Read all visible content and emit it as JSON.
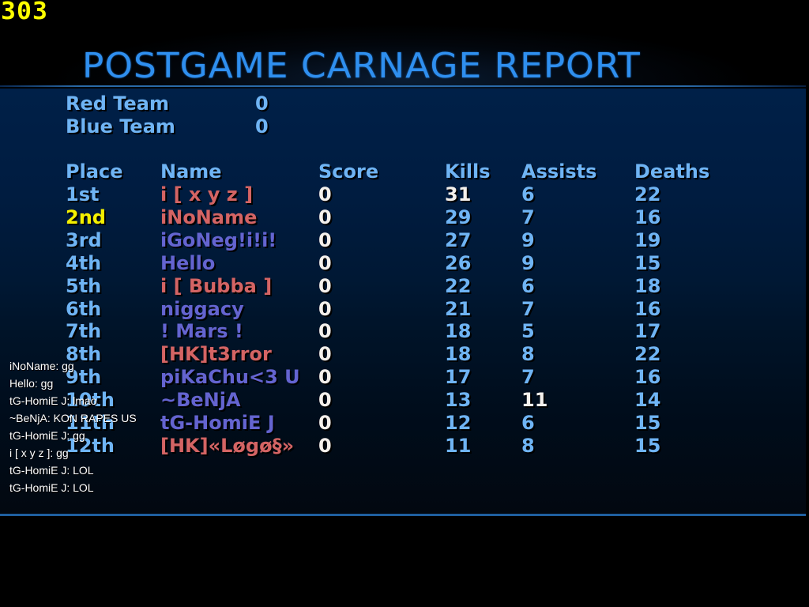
{
  "hud": {
    "fps_counter": "303"
  },
  "title": "POSTGAME CARNAGE REPORT",
  "teams": [
    {
      "name": "Red Team",
      "score": "0"
    },
    {
      "name": "Blue Team",
      "score": "0"
    }
  ],
  "columns": {
    "place": "Place",
    "name": "Name",
    "score": "Score",
    "kills": "Kills",
    "assists": "Assists",
    "deaths": "Deaths"
  },
  "colors": {
    "header_blue": "#6fb4f4",
    "title_blue": "#2f8fef",
    "highlight_yellow": "#f4f000",
    "highlight_white": "#f4f0ec",
    "red_team": "#d46464",
    "blue_team": "#6464d0"
  },
  "players": [
    {
      "place": "1st",
      "name": "i [ x y z ]",
      "team": "red",
      "score": "0",
      "kills": "31",
      "assists": "6",
      "deaths": "22",
      "place_highlight": "",
      "kills_highlight": true,
      "assists_highlight": false
    },
    {
      "place": "2nd",
      "name": "iNoName",
      "team": "red",
      "score": "0",
      "kills": "29",
      "assists": "7",
      "deaths": "16",
      "place_highlight": "yellow",
      "kills_highlight": false,
      "assists_highlight": false
    },
    {
      "place": "3rd",
      "name": "iGoNeg!i!i!",
      "team": "blue",
      "score": "0",
      "kills": "27",
      "assists": "9",
      "deaths": "19",
      "place_highlight": "",
      "kills_highlight": false,
      "assists_highlight": false
    },
    {
      "place": "4th",
      "name": "Hello",
      "team": "blue",
      "score": "0",
      "kills": "26",
      "assists": "9",
      "deaths": "15",
      "place_highlight": "",
      "kills_highlight": false,
      "assists_highlight": false
    },
    {
      "place": "5th",
      "name": "i [ Bubba ]",
      "team": "red",
      "score": "0",
      "kills": "22",
      "assists": "6",
      "deaths": "18",
      "place_highlight": "",
      "kills_highlight": false,
      "assists_highlight": false
    },
    {
      "place": "6th",
      "name": "niggacy",
      "team": "blue",
      "score": "0",
      "kills": "21",
      "assists": "7",
      "deaths": "16",
      "place_highlight": "",
      "kills_highlight": false,
      "assists_highlight": false
    },
    {
      "place": "7th",
      "name": "! Mars !",
      "team": "blue",
      "score": "0",
      "kills": "18",
      "assists": "5",
      "deaths": "17",
      "place_highlight": "",
      "kills_highlight": false,
      "assists_highlight": false
    },
    {
      "place": "8th",
      "name": "[HK]t3rror",
      "team": "red",
      "score": "0",
      "kills": "18",
      "assists": "8",
      "deaths": "22",
      "place_highlight": "",
      "kills_highlight": false,
      "assists_highlight": false
    },
    {
      "place": "9th",
      "name": "piKaChu<3 U",
      "team": "blue",
      "score": "0",
      "kills": "17",
      "assists": "7",
      "deaths": "16",
      "place_highlight": "",
      "kills_highlight": false,
      "assists_highlight": false
    },
    {
      "place": "10th",
      "name": "~BeNjA",
      "team": "blue",
      "score": "0",
      "kills": "13",
      "assists": "11",
      "deaths": "14",
      "place_highlight": "",
      "kills_highlight": false,
      "assists_highlight": true
    },
    {
      "place": "11th",
      "name": "tG-HomiE J",
      "team": "blue",
      "score": "0",
      "kills": "12",
      "assists": "6",
      "deaths": "15",
      "place_highlight": "",
      "kills_highlight": false,
      "assists_highlight": false
    },
    {
      "place": "12th",
      "name": "[HK]«Løgø§»",
      "team": "red",
      "score": "0",
      "kills": "11",
      "assists": "8",
      "deaths": "15",
      "place_highlight": "",
      "kills_highlight": false,
      "assists_highlight": false
    }
  ],
  "chat": [
    "iNoName: gg",
    "Hello: gg",
    "tG-HomiE J: lmao",
    "~BeNjA: KON RAPES US",
    "tG-HomiE J: gg",
    "i [ x y z ]: gg",
    "tG-HomiE J: LOL",
    "tG-HomiE J: LOL"
  ]
}
